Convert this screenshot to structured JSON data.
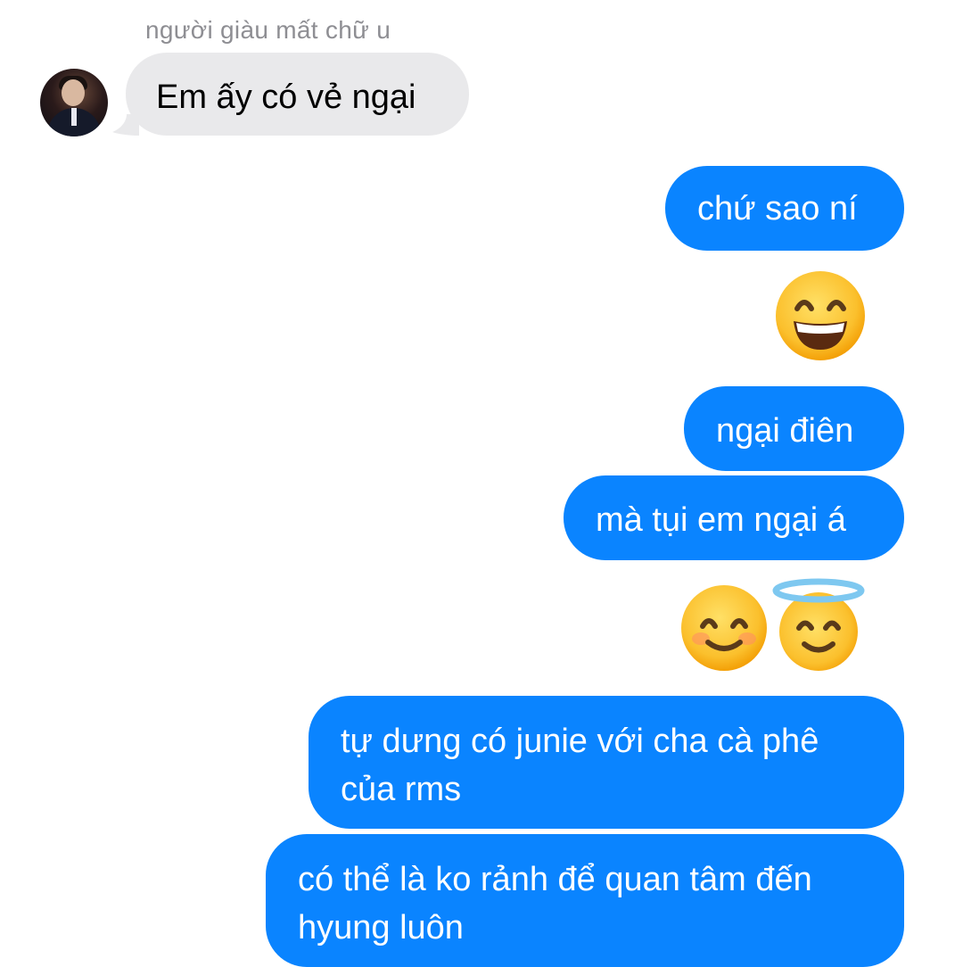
{
  "conversation": {
    "sender_name": "người giàu mất chữ u",
    "messages": [
      {
        "direction": "incoming",
        "text": "Em ấy có vẻ ngại"
      },
      {
        "direction": "outgoing",
        "text": "chứ sao ní"
      },
      {
        "direction": "outgoing",
        "emoji": "grinning-face-with-smiling-eyes"
      },
      {
        "direction": "outgoing",
        "text": "ngại điên"
      },
      {
        "direction": "outgoing",
        "text": "mà tụi em ngại á"
      },
      {
        "direction": "outgoing",
        "emoji": [
          "smiling-face-with-smiling-eyes",
          "smiling-face-with-halo"
        ]
      },
      {
        "direction": "outgoing",
        "text": "tự dưng có junie với cha cà phê\ncủa rms"
      },
      {
        "direction": "outgoing",
        "text": "có thể là ko rảnh để quan tâm đến\nhyung luôn"
      }
    ]
  },
  "colors": {
    "outgoing_bubble": "#0a84ff",
    "incoming_bubble": "#e9e9eb",
    "sender_name": "#8e8e93",
    "emoji_face": "#ffcc33",
    "halo": "#7ec8f0"
  }
}
